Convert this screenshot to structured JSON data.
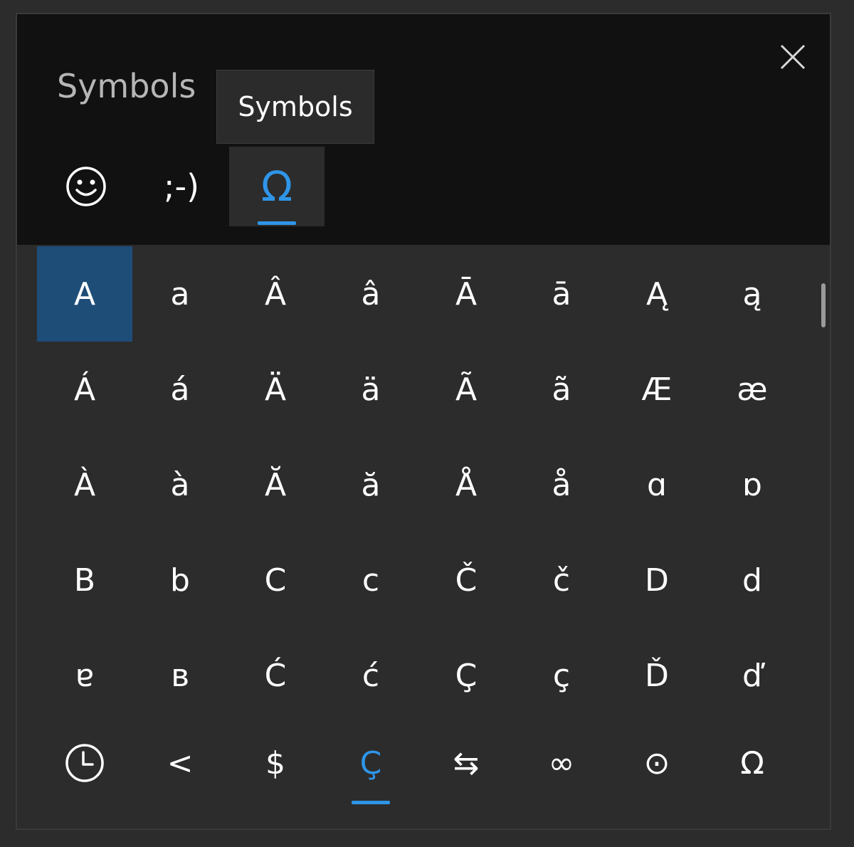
{
  "panel": {
    "title": "Symbols",
    "close_icon": "close-icon",
    "tooltip": "Symbols"
  },
  "tabs": [
    {
      "name": "emoji",
      "icon": "smiley-face-icon",
      "label": ""
    },
    {
      "name": "kaomoji",
      "icon": "",
      "label": ";-)"
    },
    {
      "name": "symbols",
      "icon": "omega-icon",
      "label": "Ω",
      "active": true
    }
  ],
  "grid": {
    "symbols": [
      "A",
      "a",
      "Â",
      "â",
      "Ā",
      "ā",
      "Ą",
      "ą",
      "Á",
      "á",
      "Ä",
      "ä",
      "Ã",
      "ã",
      "Æ",
      "æ",
      "À",
      "à",
      "Ă",
      "ă",
      "Å",
      "å",
      "ɑ",
      "ɒ",
      "B",
      "b",
      "C",
      "c",
      "Č",
      "č",
      "D",
      "d",
      "ɐ",
      "ʙ",
      "Ć",
      "ć",
      "Ç",
      "ç",
      "Ď",
      "ď"
    ],
    "selected_index": 0
  },
  "bottom_nav": [
    {
      "name": "recent",
      "icon": "clock-icon",
      "label": ""
    },
    {
      "name": "punctuation",
      "icon": "",
      "label": "<"
    },
    {
      "name": "currency",
      "icon": "",
      "label": "$"
    },
    {
      "name": "latin",
      "icon": "",
      "label": "Ç",
      "active": true
    },
    {
      "name": "geometric",
      "icon": "arrows-swap-icon",
      "label": "⇆"
    },
    {
      "name": "math",
      "icon": "",
      "label": "∞"
    },
    {
      "name": "supplemental",
      "icon": "",
      "label": "⊙"
    },
    {
      "name": "language",
      "icon": "",
      "label": "Ω"
    }
  ],
  "colors": {
    "accent": "#2f95e8",
    "selected_bg": "#1e4d78",
    "header_bg": "#111111",
    "panel_bg": "#2c2c2c"
  }
}
